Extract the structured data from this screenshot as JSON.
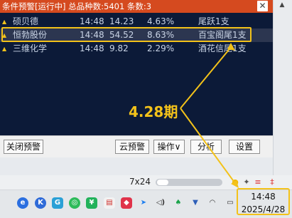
{
  "window": {
    "title": "条件预警[运行中] 总品种数:5401 条数:3",
    "close_glyph": "✕"
  },
  "alerts": [
    {
      "name": "硕贝德",
      "time": "14:48",
      "price": "14.23",
      "change": "4.63%",
      "note": "尾跃1支"
    },
    {
      "name": "恒勃股份",
      "time": "14:48",
      "price": "54.52",
      "change": "8.63%",
      "note": "百宝阁尾1支"
    },
    {
      "name": "三维化学",
      "time": "14:48",
      "price": "9.82",
      "change": "2.29%",
      "note": "酒花信尾1支"
    }
  ],
  "buttons": {
    "close_alert": "关闭预警",
    "cloud_alert": "云预警",
    "operate": "操作∨",
    "analyze": "分析",
    "settings": "设置"
  },
  "annotation": {
    "label": "4.28期",
    "color": "#f3c21a"
  },
  "status": {
    "grid_size": "7x24"
  },
  "clock": {
    "time": "14:48",
    "date": "2025/4/28"
  },
  "colors": {
    "title_bg": "#d54a1f",
    "list_bg": "#0c1a38",
    "highlight": "#f3c21a"
  },
  "taskbar_icons": [
    "browser-icon",
    "kuaishou-icon",
    "app-icon",
    "wechat-icon",
    "wechat-pay-icon",
    "note-icon",
    "red-app-icon",
    "send-icon",
    "volume-icon",
    "security-icon",
    "network-icon",
    "vpn-shield-icon",
    "wifi-icon",
    "power-icon"
  ]
}
